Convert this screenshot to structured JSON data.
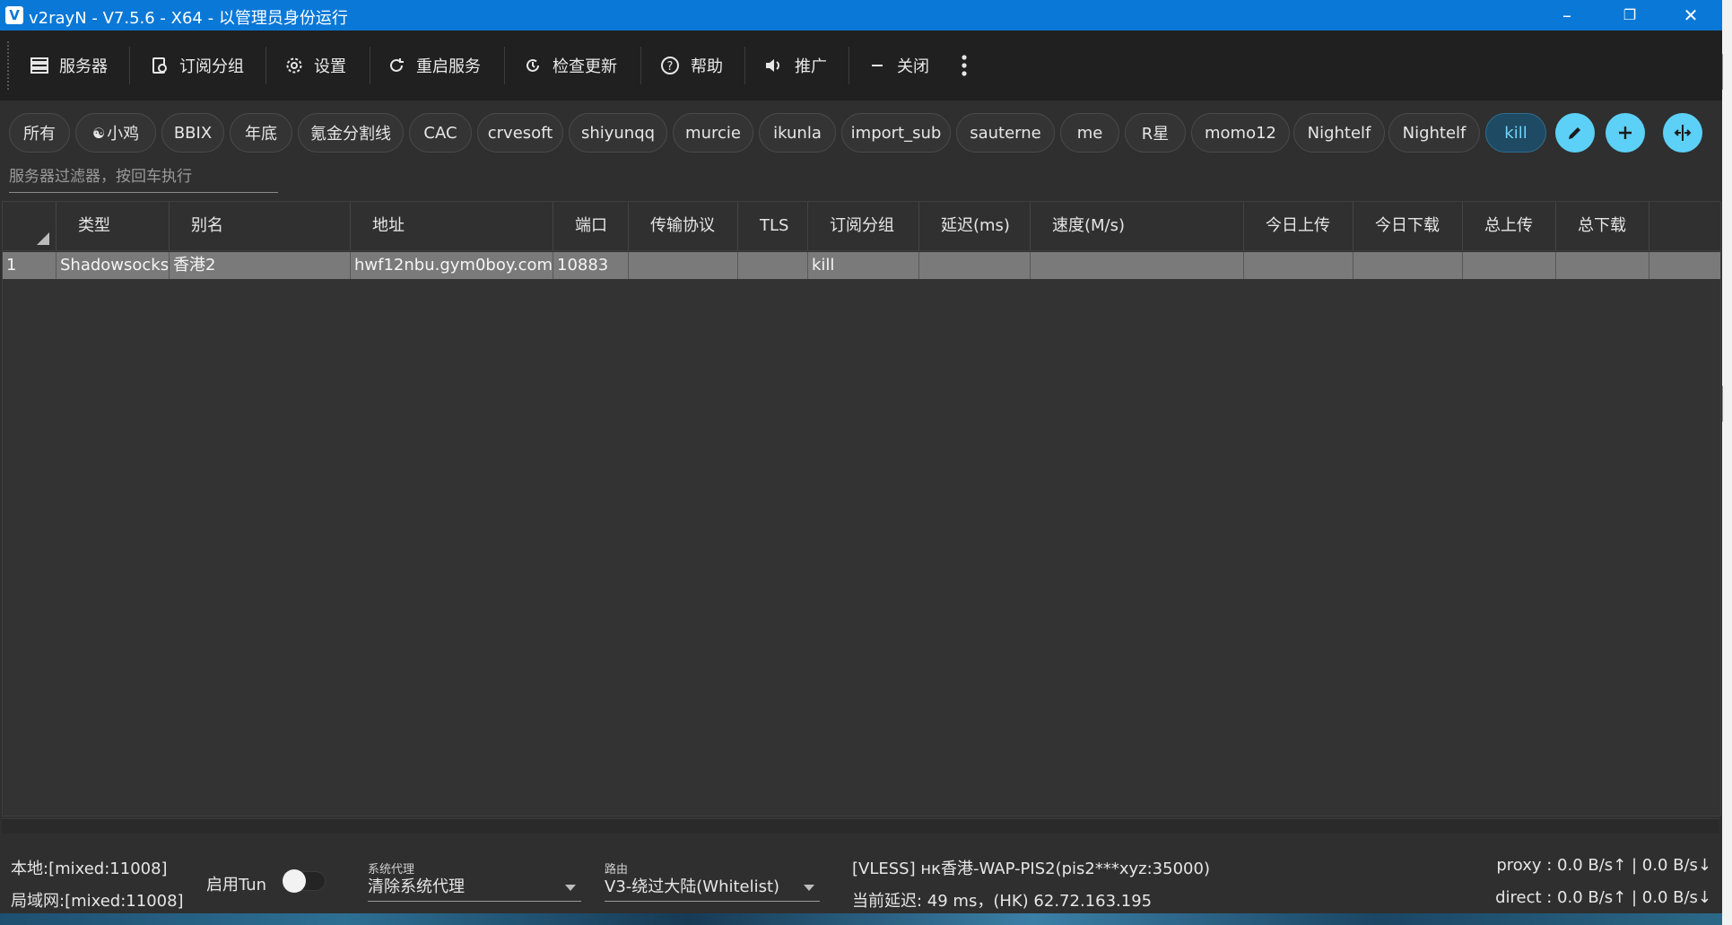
{
  "window": {
    "title": "v2rayN - V7.5.6 - X64 - 以管理员身份运行",
    "app_icon": "v2rayn-logo",
    "controls": {
      "minimize": "–",
      "maximize": "❐",
      "close": "✕"
    }
  },
  "toolbar": {
    "items": [
      {
        "label": "服务器",
        "icon": "server-icon"
      },
      {
        "label": "订阅分组",
        "icon": "subscription-icon"
      },
      {
        "label": "设置",
        "icon": "gear-icon"
      },
      {
        "label": "重启服务",
        "icon": "restart-icon"
      },
      {
        "label": "检查更新",
        "icon": "update-icon"
      },
      {
        "label": "帮助",
        "icon": "help-icon"
      },
      {
        "label": "推广",
        "icon": "speaker-icon"
      },
      {
        "label": "关闭",
        "icon": "minus-icon"
      }
    ],
    "more_icon": "more-vertical-icon"
  },
  "groups": {
    "chips": [
      "所有",
      "小鸡",
      "BBIX",
      "年底",
      "氪金分割线",
      "CAC",
      "crvesoft",
      "shiyunqq",
      "murcie",
      "ikunla",
      "import_sub",
      "sauterne",
      "me",
      "R星",
      "momo12",
      "Nightelf",
      "Nightelf",
      "kill"
    ],
    "selected": "kill",
    "actions": [
      "edit-icon",
      "add-icon",
      "split-icon"
    ]
  },
  "filter": {
    "placeholder": "服务器过滤器，按回车执行"
  },
  "table": {
    "columns": [
      "类型",
      "别名",
      "地址",
      "端口",
      "传输协议",
      "TLS",
      "订阅分组",
      "延迟(ms)",
      "速度(M/s)",
      "今日上传",
      "今日下载",
      "总上传",
      "总下载"
    ],
    "rows": [
      {
        "index": "1",
        "type": "Shadowsocks",
        "alias": "香港2",
        "address": "hwf12nbu.gym0boy.com",
        "port": "10883",
        "transport": "",
        "tls": "",
        "subgroup": "kill",
        "delay": "",
        "speed": "",
        "today_up": "",
        "today_down": "",
        "total_up": "",
        "total_down": ""
      }
    ]
  },
  "status": {
    "local": "本地:[mixed:11008]",
    "lan": "局域网:[mixed:11008]",
    "tun_label": "启用Tun",
    "tun_enabled": false,
    "system_proxy_label": "系统代理",
    "system_proxy_value": "清除系统代理",
    "routing_label": "路由",
    "routing_value": "V3-绕过大陆(Whitelist)",
    "current_server": "[VLESS] нк香港-WAP-PIS2(pis2***xyz:35000)",
    "current_delay": "当前延迟: 49 ms，(HK) 62.72.163.195",
    "proxy_speed": "proxy : 0.0 B/s↑ | 0.0 B/s↓",
    "direct_speed": "direct : 0.0 B/s↑ | 0.0 B/s↓"
  },
  "colors": {
    "titlebar": "#0a78d7",
    "accent": "#5cd0f7",
    "selected_row": "#7a7a7a"
  }
}
